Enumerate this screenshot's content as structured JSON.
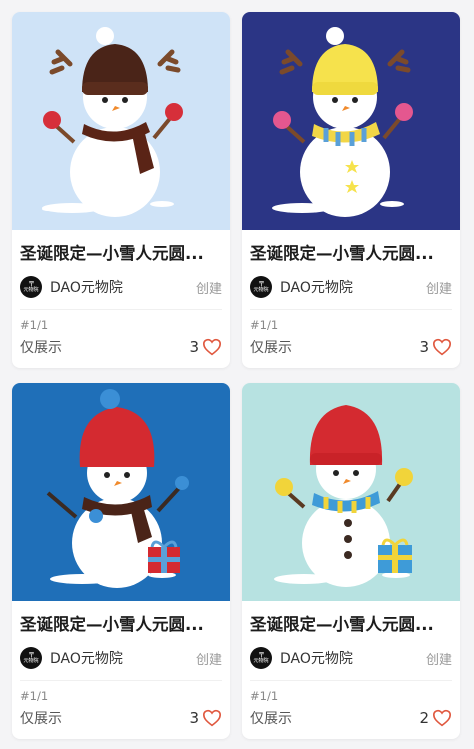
{
  "cards": [
    {
      "title": "圣诞限定—小雪人元圆...",
      "creator": "DAO元物院",
      "avatar_text": "元物院",
      "role": "创建",
      "edition": "#1/1",
      "status": "仅展示",
      "likes": "3",
      "art": {
        "bg": "#cfe3f7",
        "hat": "#4a2418",
        "scarf": "#5a2416",
        "mitten": "#d62f3a",
        "antlers": true
      }
    },
    {
      "title": "圣诞限定—小雪人元圆...",
      "creator": "DAO元物院",
      "avatar_text": "元物院",
      "role": "创建",
      "edition": "#1/1",
      "status": "仅展示",
      "likes": "3",
      "art": {
        "bg": "#2b3585",
        "hat": "#f6e24c",
        "scarf": "#f2d647",
        "mitten": "#e4578f",
        "antlers": true
      }
    },
    {
      "title": "圣诞限定—小雪人元圆...",
      "creator": "DAO元物院",
      "avatar_text": "元物院",
      "role": "创建",
      "edition": "#1/1",
      "status": "仅展示",
      "likes": "3",
      "art": {
        "bg": "#1f6fb8",
        "hat": "#d42a30",
        "scarf": "#4a2418",
        "mitten": "#3b8fd6",
        "antlers": false
      }
    },
    {
      "title": "圣诞限定—小雪人元圆...",
      "creator": "DAO元物院",
      "avatar_text": "元物院",
      "role": "创建",
      "edition": "#1/1",
      "status": "仅展示",
      "likes": "2",
      "art": {
        "bg": "#b7e2e1",
        "hat": "#d42a30",
        "scarf": "#3e9bd8",
        "mitten": "#f1d43a",
        "antlers": false
      }
    }
  ],
  "colors": {
    "heart": "#e0583f",
    "muted": "#9a9a9a"
  },
  "icons": {
    "like": "heart-outline-icon"
  }
}
